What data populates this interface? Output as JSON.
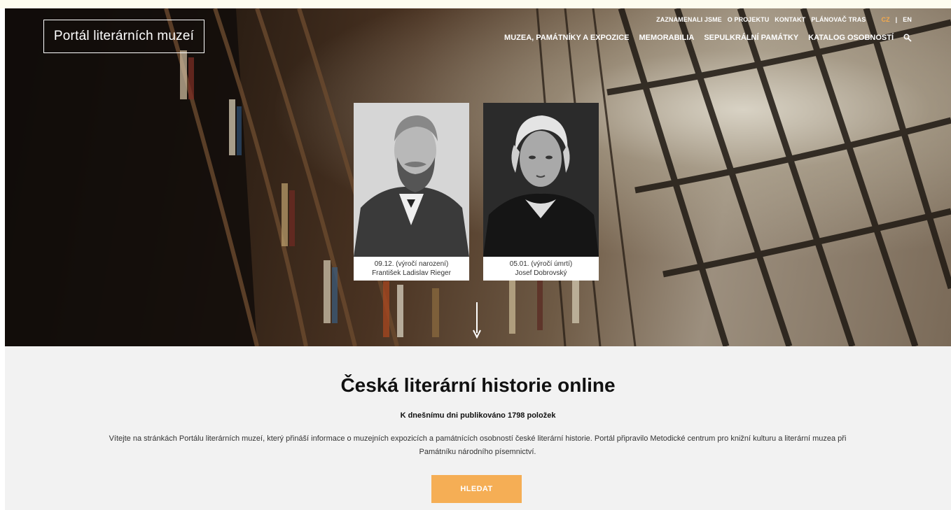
{
  "header": {
    "logo_text": "Portál literárních muzeí",
    "top_links": [
      "ZAZNAMENALI JSME",
      "O PROJEKTU",
      "KONTAKT",
      "PLÁNOVAČ TRAS"
    ],
    "lang_cz": "CZ",
    "lang_sep": "|",
    "lang_en": "EN",
    "main_links": [
      "MUZEA, PAMÁTNÍKY A EXPOZICE",
      "MEMORABILIA",
      "SEPULKRÁLNÍ PAMÁTKY",
      "KATALOG OSOBNOSTÍ"
    ],
    "search_icon": "search-icon",
    "accent_color": "#f5a94b"
  },
  "anniversaries": [
    {
      "date_note": "09.12. (výročí narození)",
      "name": "František Ladislav Rieger"
    },
    {
      "date_note": "05.01. (výročí úmrtí)",
      "name": "Josef Dobrovský"
    }
  ],
  "main": {
    "title": "Česká literární historie online",
    "count_text": "K dnešnímu dni publikováno 1798 položek",
    "intro": "Vítejte na stránkách Portálu literárních muzeí, který přináší informace o muzejních expozicích a památnících osobností české literární historie. Portál připravilo Metodické centrum pro knižní kulturu a literární muzea při Památníku národního písemnictví.",
    "search_button": "HLEDAT",
    "button_color": "#f5ae55"
  }
}
